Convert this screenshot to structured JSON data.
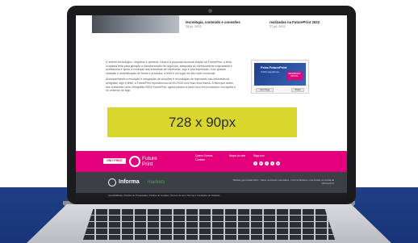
{
  "articles": [
    {
      "title": "tecnologia, conteúdo e conexões",
      "date": "28 jul, 2022"
    },
    {
      "title": "realizadas na FuturePrint 2022",
      "date": "27 jul, 2022"
    }
  ],
  "body": {
    "paragraph1": "O evento tecnológico, negócios e parceria. Essa é a proposta da sexta edição da FuturePrint, a feira completa feita para geração e transformação de negócios, adequada ao conhecimento empresarial e profissional e apoio à evolução das indústrias de impressão, sign e pôs-impressão. Com grande variação e diversificação de feiras e produtos, a feira é um lugar de alto nível comercial.",
    "paragraph2": "Acompanhando a evolução e integração de soluções e tecnologias de impressão nas indústrias de serigrafia, sign e têxtil, a FuturePrint reposicionou-se em 2019 com sua nova marca. A feira que antes era conhecida como Serigrafia SIGN FuturePrint, agora passou a fazer foco em processos, inovações e no universo do sign."
  },
  "widget": {
    "brand": "Feira FuturePrint",
    "subtitle": "3.000 seguidores",
    "chip": "IMPRESSÃO DIGITAL",
    "follow_label": "Like Page",
    "share_label": "Share"
  },
  "ad": {
    "label": "728 x 90px"
  },
  "footer": {
    "badge": "UNIT PRINT",
    "logo_line1": "Future",
    "logo_line2": "Print",
    "col1": [
      "Quem Somos",
      "Contato"
    ],
    "col2": [
      "Mapa do site"
    ],
    "col3_title": "Siga-nos",
    "social": [
      "f",
      "in",
      "t",
      "y",
      "ig"
    ]
  },
  "informa": {
    "name": "Informa",
    "sub": "markets",
    "copyright": "Website gerenciado 2021 - Todos os direitos reservados - Informa Markets, uma divisão comercial da Informa PLC"
  },
  "legal": "Acessibilidade | Política de Privacidade | Política de Cookies | Termos de uso | Termos e Condições do Visitante"
}
